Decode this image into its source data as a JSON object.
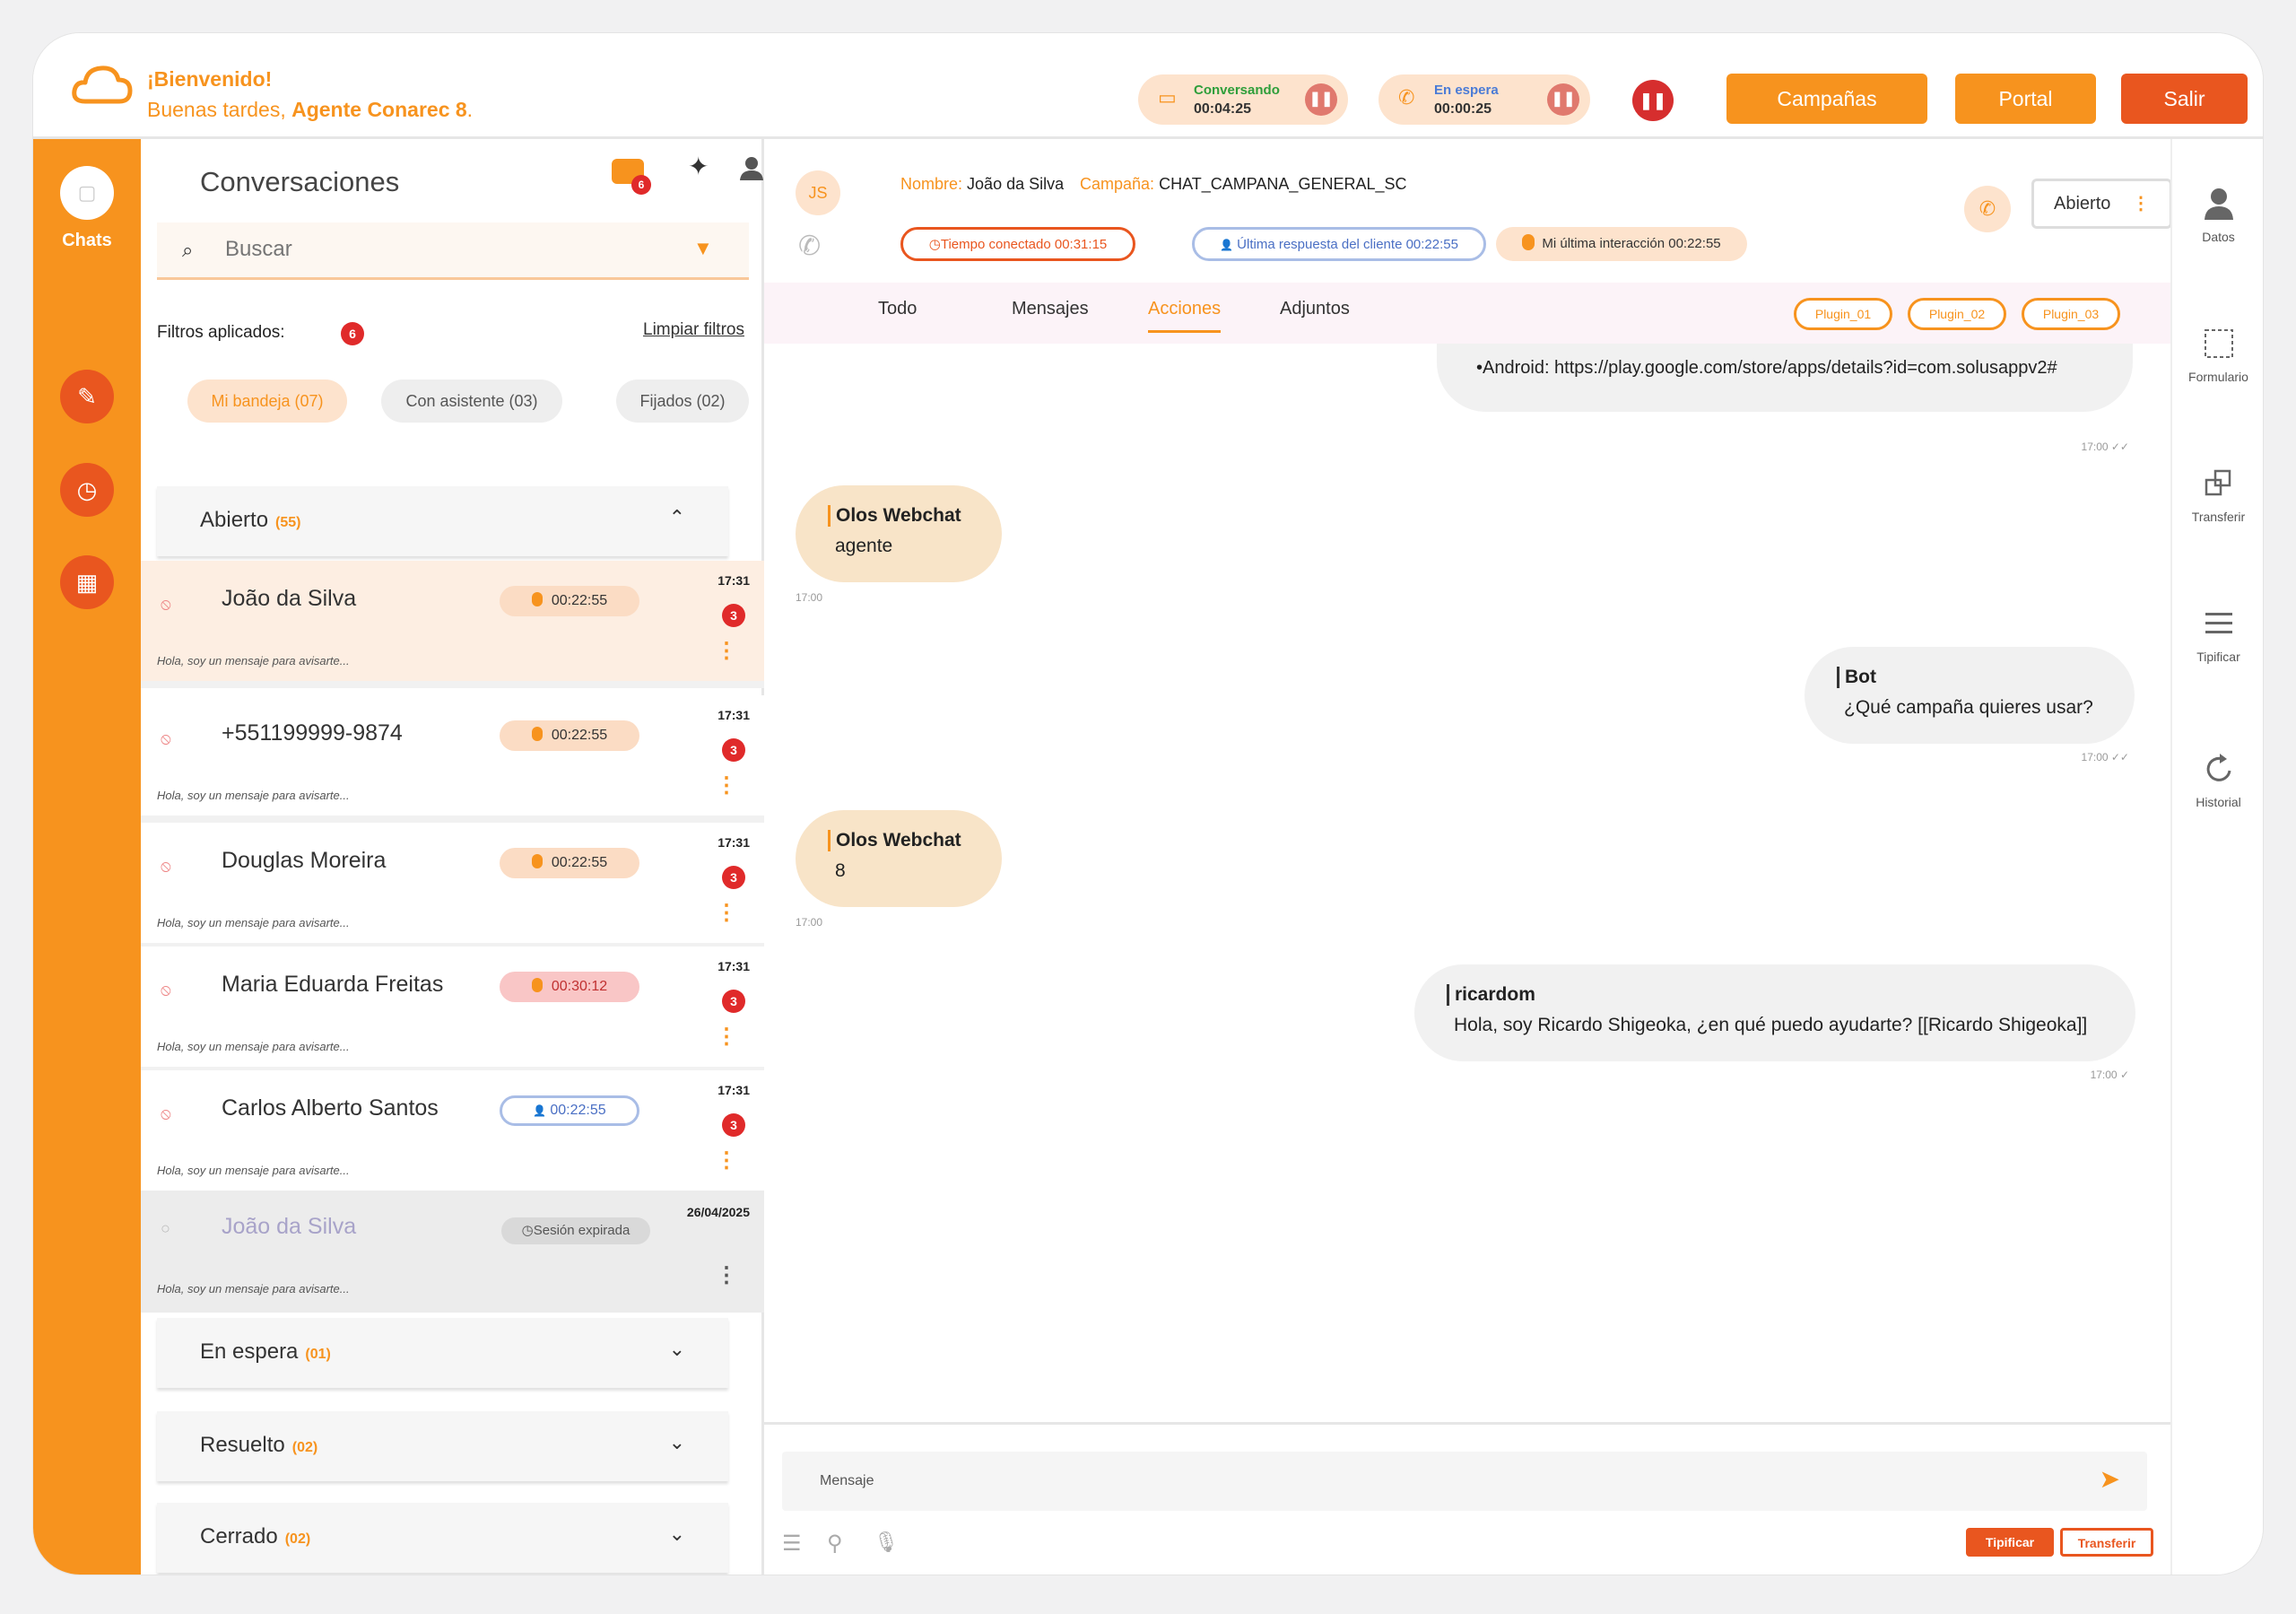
{
  "header": {
    "greeting": "¡Bienvenido!",
    "subgreeting_prefix": "Buenas tardes, ",
    "agent_name": "Agente Conarec 8",
    "subgreeting_suffix": ".",
    "status": [
      {
        "icon": "chat-status-icon",
        "label": "Conversando",
        "time": "00:04:25",
        "color": "#2e9e3a"
      },
      {
        "icon": "phone-status-icon",
        "label": "En espera",
        "time": "00:00:25",
        "color": "#4a7bd6"
      }
    ],
    "buttons": {
      "campaigns": "Campañas",
      "portal": "Portal",
      "logout": "Salir"
    },
    "colors": {
      "accent": "#f7931e",
      "danger": "#e9561f"
    }
  },
  "rail": {
    "chats_label": "Chats"
  },
  "conversations": {
    "title": "Conversaciones",
    "notif_count": "6",
    "search_placeholder": "Buscar",
    "filters_label": "Filtros aplicados:",
    "filters_count": "6",
    "clear_filters": "Limpiar filtros",
    "chips": [
      "Mi bandeja (07)",
      "Con asistente (03)",
      "Fijados (02)"
    ],
    "sections": {
      "open": {
        "name": "Abierto",
        "count": "(55)"
      },
      "waiting": {
        "name": "En espera",
        "count": "(01)"
      },
      "resolved": {
        "name": "Resuelto",
        "count": "(02)"
      },
      "closed": {
        "name": "Cerrado",
        "count": "(02)"
      }
    },
    "items": [
      {
        "name": "João da Silva",
        "timer": "00:22:55",
        "time": "17:31",
        "count": "3",
        "preview": "Hola, soy un mensaje para avisarte..."
      },
      {
        "name": "+551199999-9874",
        "timer": "00:22:55",
        "time": "17:31",
        "count": "3",
        "preview": "Hola, soy un mensaje para avisarte..."
      },
      {
        "name": "Douglas Moreira",
        "timer": "00:22:55",
        "time": "17:31",
        "count": "3",
        "preview": "Hola, soy un mensaje para avisarte..."
      },
      {
        "name": "Maria Eduarda Freitas",
        "timer": "00:30:12",
        "time": "17:31",
        "count": "3",
        "preview": "Hola, soy un mensaje para avisarte..."
      },
      {
        "name": "Carlos Alberto Santos",
        "timer": "00:22:55",
        "time": "17:31",
        "count": "3",
        "preview": "Hola, soy un mensaje para avisarte..."
      },
      {
        "name": "João da Silva",
        "timer": "Sesión expirada",
        "time": "26/04/2025",
        "preview": "Hola, soy un mensaje para avisarte..."
      }
    ]
  },
  "chat": {
    "avatar_initials": "JS",
    "name_label": "Nombre:",
    "name_value": "João da Silva",
    "campaign_label": "Campaña:",
    "campaign_value": "CHAT_CAMPANA_GENERAL_SC",
    "status_value": "Abierto",
    "time_connected": "Tiempo conectado 00:31:15",
    "last_client_reply": "Última respuesta del cliente 00:22:55",
    "my_last_interaction": "Mi última interacción 00:22:55",
    "tabs": [
      "Todo",
      "Mensajes",
      "Acciones",
      "Adjuntos"
    ],
    "plugins": [
      "Plugin_01",
      "Plugin_02",
      "Plugin_03"
    ],
    "messages": [
      {
        "text": "•Android: https://play.google.com/store/apps/details?id=com.solusappv2#",
        "stamp": "17:00 ✓✓"
      },
      {
        "who": "Olos Webchat",
        "text": "agente",
        "stamp": "17:00"
      },
      {
        "who": "Bot",
        "text": "¿Qué campaña quieres usar?",
        "stamp": "17:00 ✓✓"
      },
      {
        "who": "Olos Webchat",
        "text": "8",
        "stamp": "17:00"
      },
      {
        "who": "ricardom",
        "text": "Hola, soy Ricardo Shigeoka, ¿en qué puedo ayudarte? [[Ricardo Shigeoka]]",
        "stamp": "17:00 ✓"
      }
    ],
    "composer_placeholder": "Mensaje",
    "tipificar": "Tipificar",
    "transferir": "Transferir"
  },
  "right_rail": [
    "Datos",
    "Formulario",
    "Transferir",
    "Tipificar",
    "Historial"
  ]
}
